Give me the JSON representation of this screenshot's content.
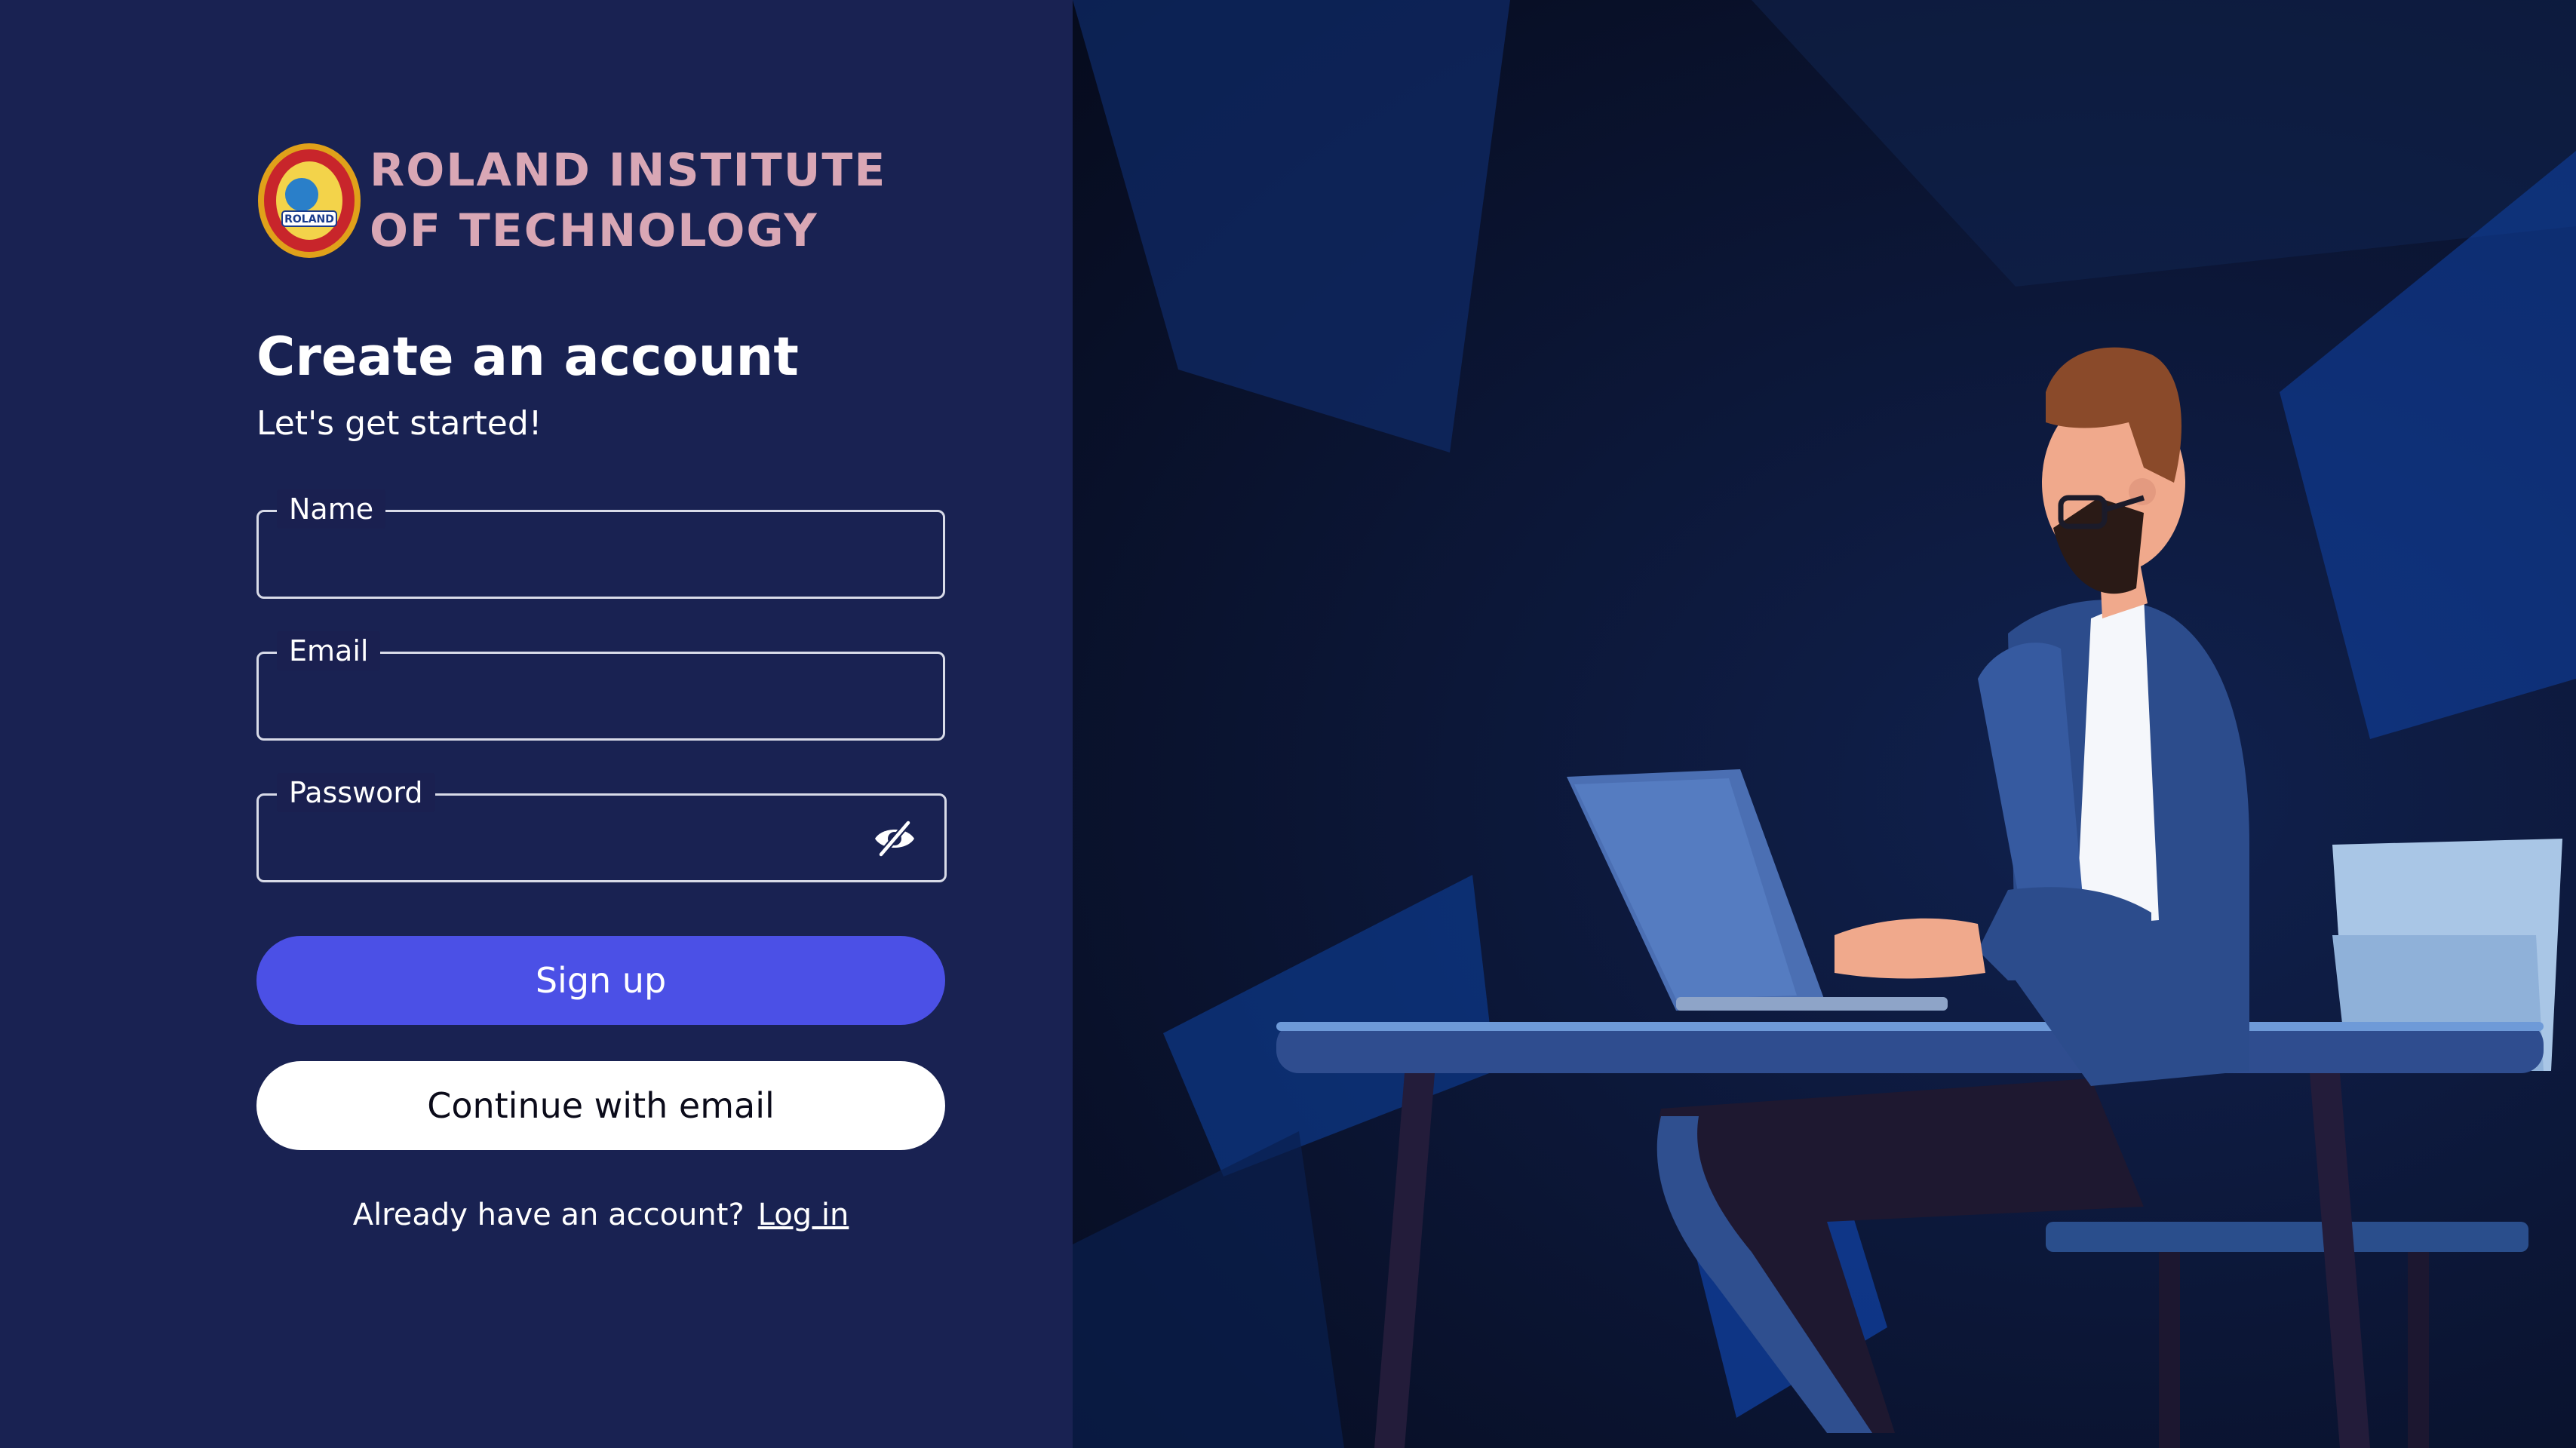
{
  "brand": {
    "line1": "ROLAND INSTITUTE",
    "line2": "OF TECHNOLOGY",
    "logo_icon": "roland-crest-logo"
  },
  "form": {
    "title": "Create an account",
    "subtitle": "Let's get started!",
    "name_label": "Name",
    "name_value": "",
    "email_label": "Email",
    "email_value": "",
    "password_label": "Password",
    "password_value": "",
    "password_toggle_icon": "eye-slash-icon"
  },
  "actions": {
    "signup_label": "Sign up",
    "continue_email_label": "Continue with email"
  },
  "footer": {
    "prompt": "Already have an account?",
    "login_label": "Log in"
  },
  "colors": {
    "panel_bg": "#192252",
    "primary_button": "#4b50e6",
    "brand_text": "#d9a7b5"
  },
  "illustration": {
    "icon": "man-working-on-laptop-illustration"
  }
}
